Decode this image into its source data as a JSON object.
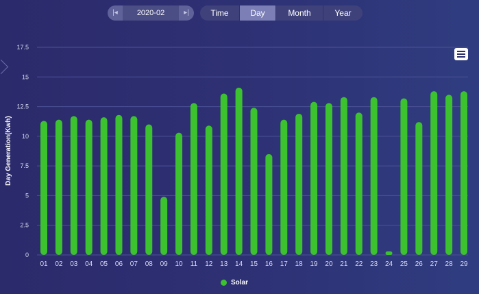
{
  "toolbar": {
    "date_value": "2020-02",
    "prev_icon": "step-backward-icon",
    "next_icon": "step-forward-icon",
    "tabs": [
      {
        "label": "Time",
        "active": false
      },
      {
        "label": "Day",
        "active": true
      },
      {
        "label": "Month",
        "active": false
      },
      {
        "label": "Year",
        "active": false
      }
    ]
  },
  "colors": {
    "bar": "#3cc12f",
    "grid": "#4d5296",
    "axis_text": "#d8daf0",
    "active_tab": "#7b7fb6"
  },
  "chart_menu_icon": "hamburger-menu-icon",
  "side_toggle_icon": "chevron-right-icon",
  "chart_data": {
    "type": "bar",
    "ylabel": "Day Generation(Kwh)",
    "xlabel": "",
    "ylim": [
      0,
      17.5
    ],
    "yticks": [
      "0",
      "2.5",
      "5",
      "7.5",
      "10",
      "12.5",
      "15",
      "17.5"
    ],
    "grid": true,
    "legend_position": "bottom",
    "categories": [
      "01",
      "02",
      "03",
      "04",
      "05",
      "06",
      "07",
      "08",
      "09",
      "10",
      "11",
      "12",
      "13",
      "14",
      "15",
      "16",
      "17",
      "18",
      "19",
      "20",
      "21",
      "22",
      "23",
      "24",
      "25",
      "26",
      "27",
      "28",
      "29"
    ],
    "series": [
      {
        "name": "Solar",
        "values": [
          11.3,
          11.4,
          11.7,
          11.4,
          11.6,
          11.8,
          11.7,
          11.0,
          4.9,
          10.3,
          12.8,
          10.9,
          13.6,
          14.1,
          12.4,
          8.5,
          11.4,
          11.9,
          12.9,
          12.8,
          13.3,
          12.0,
          13.3,
          0.3,
          13.2,
          11.2,
          13.8,
          13.5,
          13.8
        ]
      }
    ]
  }
}
